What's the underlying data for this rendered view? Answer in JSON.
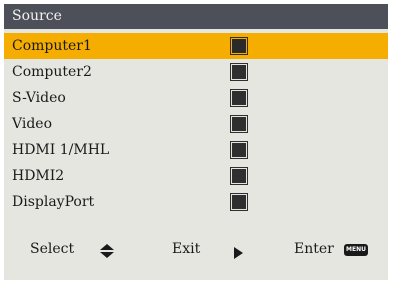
{
  "title": "Source",
  "items": [
    {
      "label": "Computer1",
      "selected": true
    },
    {
      "label": "Computer2",
      "selected": false
    },
    {
      "label": "S-Video",
      "selected": false
    },
    {
      "label": "Video",
      "selected": false
    },
    {
      "label": "HDMI 1/MHL",
      "selected": false
    },
    {
      "label": "HDMI2",
      "selected": false
    },
    {
      "label": "DisplayPort",
      "selected": false
    }
  ],
  "footer": {
    "select_label": "Select",
    "select_icon": "up-down-arrows-icon",
    "exit_label": "Exit",
    "exit_icon": "right-arrow-icon",
    "enter_label": "Enter",
    "enter_icon_text": "MENU"
  },
  "colors": {
    "background": "#e6e6e0",
    "titlebar": "#4d4f59",
    "highlight": "#f5ad00"
  }
}
